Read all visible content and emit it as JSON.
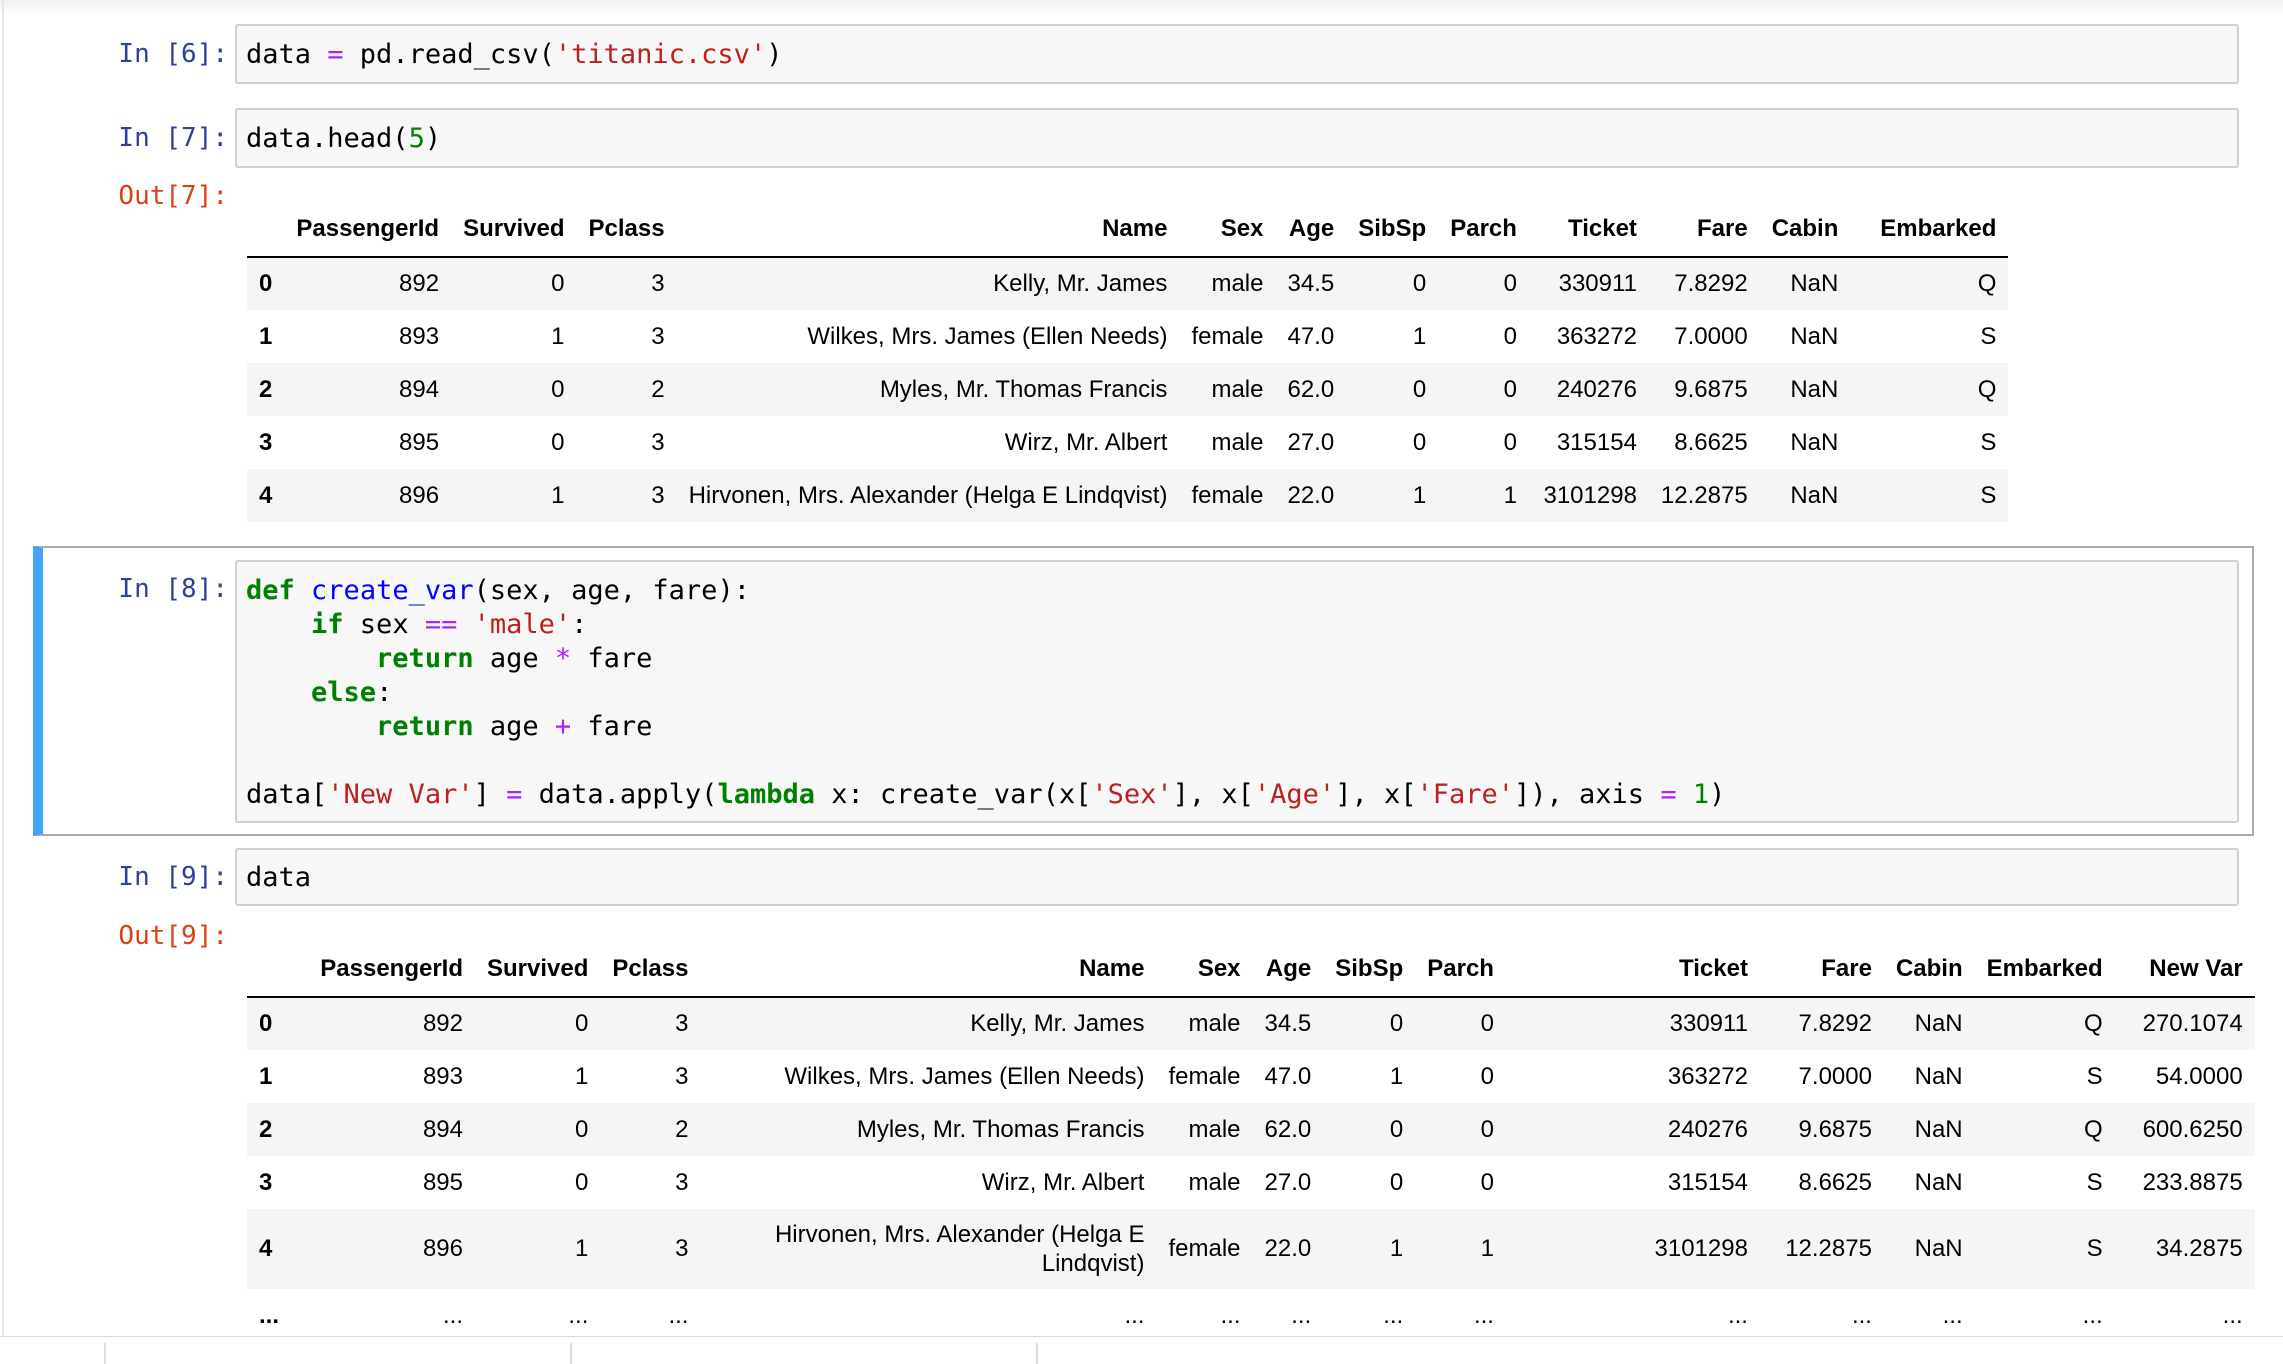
{
  "cells": {
    "c6": {
      "prompt": "In [6]:"
    },
    "c7": {
      "prompt": "In [7]:",
      "out_prompt": "Out[7]:"
    },
    "c8": {
      "prompt": "In [8]:"
    },
    "c9": {
      "prompt": "In [9]:",
      "out_prompt": "Out[9]:",
      "code": "data"
    }
  },
  "code_tokens": {
    "c6": {
      "a": "data ",
      "op": "=",
      "b": " pd.read_csv(",
      "s": "'titanic.csv'",
      "c": ")"
    },
    "c7": {
      "a": "data.head(",
      "n": "5",
      "c": ")"
    },
    "c8": {
      "def": "def",
      "fname": "create_var",
      "sig": "(sex, age, fare):",
      "if": "if",
      "sex_var": " sex ",
      "eqeq": "==",
      "male": "'male'",
      "colon": ":",
      "return": "return",
      "age_mul": " age ",
      "mul": "*",
      "fare": " fare",
      "else": "else",
      "age_add": " age ",
      "add": "+",
      "data_open": "data[",
      "newvar": "'New Var'",
      "bracket_eq": "] ",
      "eq": "=",
      "apply": " data.apply(",
      "lambda": "lambda",
      "lam_rest": " x: create_var(x[",
      "sex_s": "'Sex'",
      "sep1": "], x[",
      "age_s": "'Age'",
      "sep2": "], x[",
      "fare_s": "'Fare'",
      "tail": "]), axis ",
      "eq2": "=",
      "one": " 1",
      "close": ")"
    }
  },
  "df7": {
    "columns": [
      "",
      "PassengerId",
      "Survived",
      "Pclass",
      "Name",
      "Sex",
      "Age",
      "SibSp",
      "Parch",
      "Ticket",
      "Fare",
      "Cabin",
      "Embarked"
    ],
    "rows": [
      [
        "0",
        "892",
        "0",
        "3",
        "Kelly, Mr. James",
        "male",
        "34.5",
        "0",
        "0",
        "330911",
        "7.8292",
        "NaN",
        "Q"
      ],
      [
        "1",
        "893",
        "1",
        "3",
        "Wilkes, Mrs. James (Ellen Needs)",
        "female",
        "47.0",
        "1",
        "0",
        "363272",
        "7.0000",
        "NaN",
        "S"
      ],
      [
        "2",
        "894",
        "0",
        "2",
        "Myles, Mr. Thomas Francis",
        "male",
        "62.0",
        "0",
        "0",
        "240276",
        "9.6875",
        "NaN",
        "Q"
      ],
      [
        "3",
        "895",
        "0",
        "3",
        "Wirz, Mr. Albert",
        "male",
        "27.0",
        "0",
        "0",
        "315154",
        "8.6625",
        "NaN",
        "S"
      ],
      [
        "4",
        "896",
        "1",
        "3",
        "Hirvonen, Mrs. Alexander (Helga E Lindqvist)",
        "female",
        "22.0",
        "1",
        "1",
        "3101298",
        "12.2875",
        "NaN",
        "S"
      ]
    ]
  },
  "df9": {
    "columns": [
      "",
      "PassengerId",
      "Survived",
      "Pclass",
      "Name",
      "Sex",
      "Age",
      "SibSp",
      "Parch",
      "Ticket",
      "Fare",
      "Cabin",
      "Embarked",
      "New Var"
    ],
    "rows": [
      [
        "0",
        "892",
        "0",
        "3",
        "Kelly, Mr. James",
        "male",
        "34.5",
        "0",
        "0",
        "330911",
        "7.8292",
        "NaN",
        "Q",
        "270.1074"
      ],
      [
        "1",
        "893",
        "1",
        "3",
        "Wilkes, Mrs. James (Ellen Needs)",
        "female",
        "47.0",
        "1",
        "0",
        "363272",
        "7.0000",
        "NaN",
        "S",
        "54.0000"
      ],
      [
        "2",
        "894",
        "0",
        "2",
        "Myles, Mr. Thomas Francis",
        "male",
        "62.0",
        "0",
        "0",
        "240276",
        "9.6875",
        "NaN",
        "Q",
        "600.6250"
      ],
      [
        "3",
        "895",
        "0",
        "3",
        "Wirz, Mr. Albert",
        "male",
        "27.0",
        "0",
        "0",
        "315154",
        "8.6625",
        "NaN",
        "S",
        "233.8875"
      ],
      [
        "4",
        "896",
        "1",
        "3",
        "Hirvonen, Mrs. Alexander (Helga E Lindqvist)",
        "female",
        "22.0",
        "1",
        "1",
        "3101298",
        "12.2875",
        "NaN",
        "S",
        "34.2875"
      ],
      [
        "...",
        "...",
        "...",
        "...",
        "...",
        "...",
        "...",
        "...",
        "...",
        "...",
        "...",
        "...",
        "...",
        "..."
      ]
    ]
  }
}
